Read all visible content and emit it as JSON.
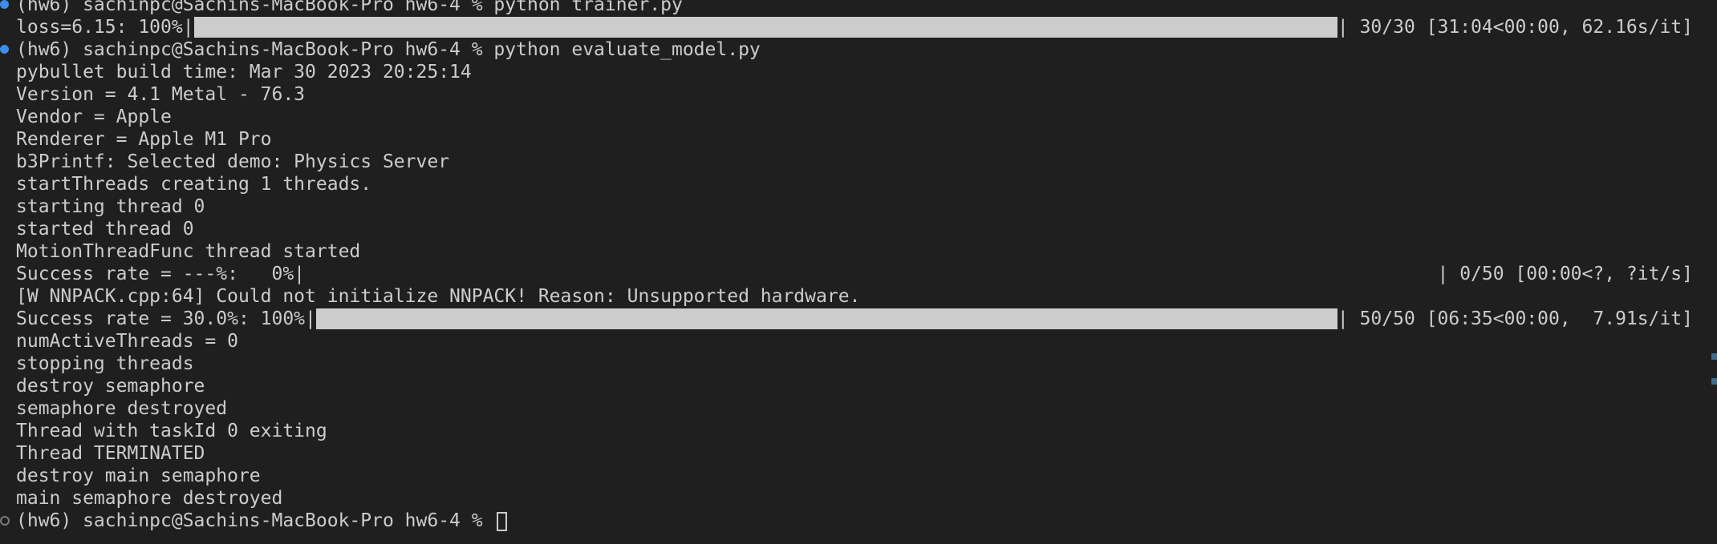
{
  "terminal": {
    "partial_top_line": "(hw6) sachinpc@Sachins-MacBook-Pro hw6-4 % python trainer.py",
    "lines": [
      {
        "kind": "prompt",
        "text": "(hw6) sachinpc@Sachins-MacBook-Pro hw6-4 % python trainer.py"
      },
      {
        "kind": "progress",
        "prefix": "loss=6.15: 100%|",
        "suffix": "| 30/30 [31:04<00:00, 62.16s/it]",
        "fraction": 1.0
      },
      {
        "kind": "prompt",
        "text": "(hw6) sachinpc@Sachins-MacBook-Pro hw6-4 % python evaluate_model.py"
      },
      {
        "kind": "text",
        "text": "pybullet build time: Mar 30 2023 20:25:14"
      },
      {
        "kind": "text",
        "text": "Version = 4.1 Metal - 76.3"
      },
      {
        "kind": "text",
        "text": "Vendor = Apple"
      },
      {
        "kind": "text",
        "text": "Renderer = Apple M1 Pro"
      },
      {
        "kind": "text",
        "text": "b3Printf: Selected demo: Physics Server"
      },
      {
        "kind": "text",
        "text": "startThreads creating 1 threads."
      },
      {
        "kind": "text",
        "text": "starting thread 0"
      },
      {
        "kind": "text",
        "text": "started thread 0"
      },
      {
        "kind": "text",
        "text": "MotionThreadFunc thread started"
      },
      {
        "kind": "progress",
        "prefix": "Success rate = ---%:   0%|",
        "suffix": "| 0/50 [00:00<?, ?it/s]",
        "fraction": 0.0
      },
      {
        "kind": "text",
        "text": "[W NNPACK.cpp:64] Could not initialize NNPACK! Reason: Unsupported hardware."
      },
      {
        "kind": "progress",
        "prefix": "Success rate = 30.0%: 100%|",
        "suffix": "| 50/50 [06:35<00:00,  7.91s/it]",
        "fraction": 1.0
      },
      {
        "kind": "text",
        "text": "numActiveThreads = 0"
      },
      {
        "kind": "text",
        "text": "stopping threads"
      },
      {
        "kind": "text",
        "text": "destroy semaphore"
      },
      {
        "kind": "text",
        "text": "semaphore destroyed"
      },
      {
        "kind": "text",
        "text": "Thread with taskId 0 exiting"
      },
      {
        "kind": "text",
        "text": "Thread TERMINATED"
      },
      {
        "kind": "text",
        "text": "destroy main semaphore"
      },
      {
        "kind": "text",
        "text": "main semaphore destroyed"
      },
      {
        "kind": "prompt-active",
        "text": "(hw6) sachinpc@Sachins-MacBook-Pro hw6-4 % "
      }
    ]
  },
  "colors": {
    "background": "#1f1f1f",
    "foreground": "#cccccc",
    "progress_fill": "#cccccc",
    "decoration_success": "#3b8eea",
    "decoration_pending": "#7a7a7a"
  },
  "icons": {
    "command_decoration": "command-decoration-icon",
    "cursor": "block-cursor"
  }
}
